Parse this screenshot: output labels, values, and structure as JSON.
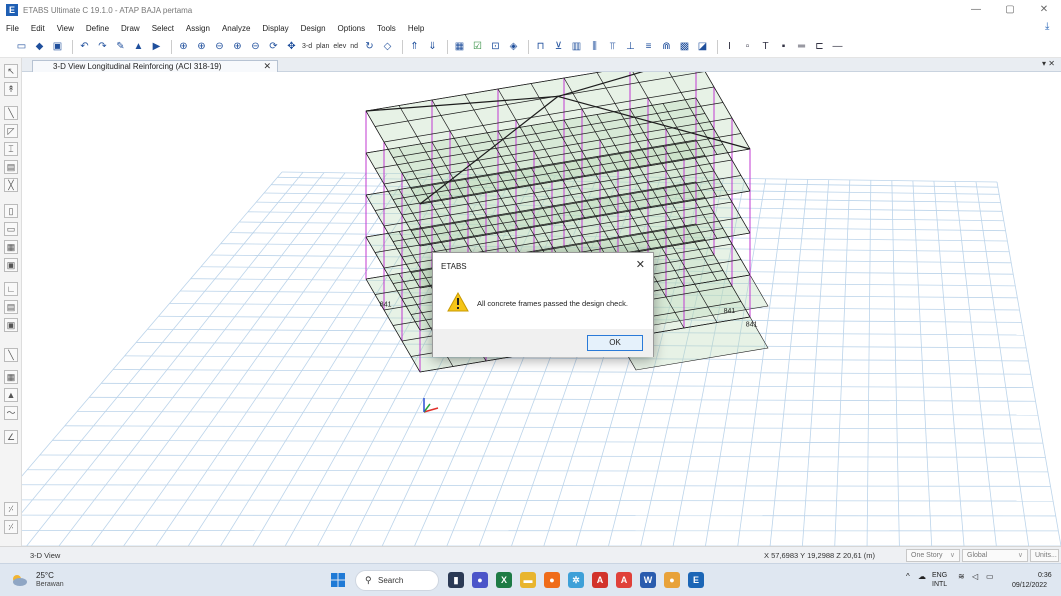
{
  "window": {
    "title": "ETABS Ultimate C 19.1.0 - ATAP BAJA pertama",
    "logo_letter": "E",
    "minimize_glyph": "—",
    "maximize_glyph": "▢",
    "close_glyph": "✕"
  },
  "menu": {
    "items": [
      "File",
      "Edit",
      "View",
      "Define",
      "Draw",
      "Select",
      "Assign",
      "Analyze",
      "Display",
      "Design",
      "Options",
      "Tools",
      "Help"
    ]
  },
  "toolbar": {
    "text_items": [
      "3-d",
      "plan",
      "elev",
      "nd"
    ],
    "icon_names": [
      "new-model-icon",
      "open-icon",
      "save-icon",
      "undo-icon",
      "redo-icon",
      "draw-icon",
      "lock-icon",
      "run-icon",
      "zoom-window-icon",
      "zoom-in-icon",
      "zoom-out-icon",
      "zoom-fit-icon",
      "zoom-prev-icon",
      "rotate-3d-icon",
      "pan-icon"
    ]
  },
  "tab": {
    "label": "3-D View  Longitudinal Reinforcing  (ACI 318-19)",
    "close_glyph": "✕",
    "strip_close_glyph": "▾ ✕"
  },
  "viewport": {
    "model_label": "841",
    "axis_colors": {
      "x": "#e0302a",
      "y": "#22a33a",
      "z": "#2a4fd6"
    },
    "grid_color": "#bcd4ea",
    "column_color": "#c23ad1",
    "frame_color": "#1c1c1c",
    "shell_color": "#b9d9b6"
  },
  "dialog": {
    "title": "ETABS",
    "message": "All concrete frames passed the design check.",
    "ok_label": "OK",
    "close_glyph": "✕"
  },
  "statusbar": {
    "view_name": "3-D View",
    "coords": "X 57,6983  Y 19,2988  Z 20,61 (m)",
    "story_select": "One Story",
    "coord_system": "Global",
    "units": "Units..."
  },
  "taskbar": {
    "temperature": "25°C",
    "weather": "Berawan",
    "search_label": "Search",
    "lang_top": "ENG",
    "lang_bottom": "INTL",
    "time": "0:36",
    "date": "09/12/2022"
  }
}
